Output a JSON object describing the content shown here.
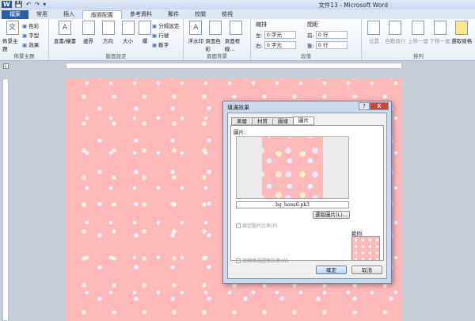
{
  "window": {
    "title": "文件13 - Microsoft Word",
    "app_icon": "W"
  },
  "qat": {
    "save": "💾",
    "undo": "↶",
    "redo": "↷",
    "customize": "▾"
  },
  "tabs": [
    "檔案",
    "常用",
    "插入",
    "版面配置",
    "參考資料",
    "郵件",
    "校閱",
    "檢視"
  ],
  "ribbon": {
    "themes": {
      "label": "佈景主題",
      "big": "佈景主題",
      "small": [
        "色彩",
        "字型",
        "效果"
      ]
    },
    "page_setup": {
      "label": "版面設定",
      "big": [
        "直書/橫書",
        "邊界",
        "方向",
        "大小",
        "欄"
      ],
      "small": [
        "分隔設定",
        "行號",
        "斷字"
      ]
    },
    "page_bg": {
      "label": "頁面背景",
      "big": [
        "浮水印",
        "頁面色彩",
        "頁面框線..."
      ]
    },
    "paragraph": {
      "label": "段落",
      "indent_title": "縮排",
      "left_label": "左:",
      "left_value": "0 字元",
      "right_label": "右:",
      "right_value": "0 字元",
      "spacing_title": "間距",
      "before_label": "前:",
      "before_value": "0 行",
      "after_label": "後:",
      "after_value": "0 行"
    },
    "arrange": {
      "label": "排列",
      "big": [
        "位置",
        "自動換行",
        "上移一層",
        "下移一層",
        "選取窗格"
      ]
    }
  },
  "dialog": {
    "title": "填滿效果",
    "help": "?",
    "close": "X",
    "tabs": [
      "漸層",
      "材質",
      "圖樣",
      "圖片"
    ],
    "active_tab": 3,
    "picture_label": "圖片:",
    "filename": "bg_hana6-pk3",
    "select_button": "選取圖片(L)...",
    "lock_ratio": "鎖定圖片比率(P)",
    "rotate": "旋轉填滿圖案效果(W)",
    "sample_label": "範例:",
    "ok": "確定",
    "cancel": "取消"
  }
}
